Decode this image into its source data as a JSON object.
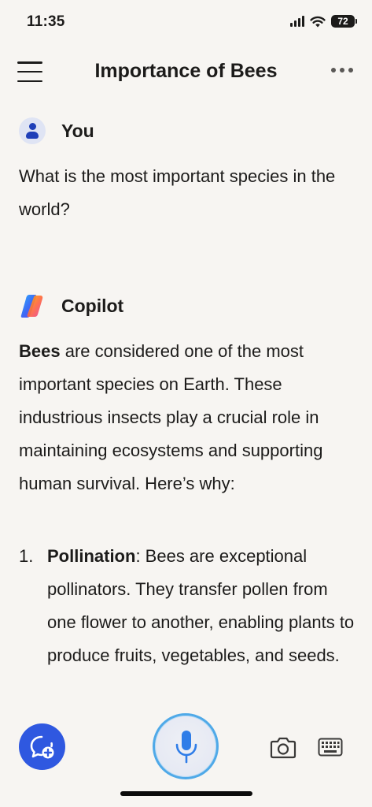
{
  "status_bar": {
    "time": "11:35",
    "battery": "72"
  },
  "header": {
    "title": "Importance of Bees"
  },
  "user_message": {
    "author": "You",
    "text": "What is the most important species in the world?"
  },
  "copilot_message": {
    "author": "Copilot",
    "intro_bold": "Bees",
    "intro_rest": " are considered one of the most important species on Earth. These industrious insects play a crucial role in maintaining ecosystems and supporting human survival. Here’s why:",
    "list": [
      {
        "number": "1.",
        "title": "Pollination",
        "text": ": Bees are exceptional pollinators. They transfer pollen from one flower to another, enabling plants to produce fruits, vegetables, and seeds."
      }
    ]
  },
  "icons": {
    "menu": "hamburger-menu-icon",
    "more": "ellipsis-icon",
    "new_chat": "chat-plus-icon",
    "mic": "microphone-icon",
    "camera": "camera-icon",
    "keyboard": "keyboard-icon"
  },
  "colors": {
    "accent_blue": "#2f58e0",
    "mic_ring": "#4fa9e8",
    "background": "#f7f5f2"
  }
}
